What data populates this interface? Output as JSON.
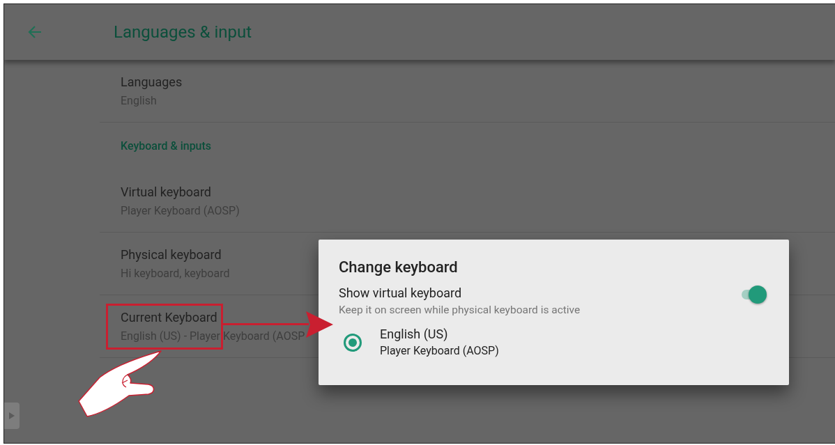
{
  "app_bar": {
    "title": "Languages & input"
  },
  "sections": [
    {
      "items": [
        {
          "title": "Languages",
          "summary": "English",
          "highlighted": false
        }
      ]
    },
    {
      "header": "Keyboard & inputs",
      "items": [
        {
          "title": "Virtual keyboard",
          "summary": "Player Keyboard (AOSP)",
          "highlighted": false
        },
        {
          "title": "Physical keyboard",
          "summary": "Hi keyboard, keyboard",
          "highlighted": false
        },
        {
          "title": "Current Keyboard",
          "summary": "English (US) - Player Keyboard (AOSP",
          "highlighted": true
        }
      ]
    }
  ],
  "dialog": {
    "title": "Change keyboard",
    "switch": {
      "label": "Show virtual keyboard",
      "summary": "Keep it on screen while physical keyboard is active",
      "on": true
    },
    "options": [
      {
        "title": "English (US)",
        "summary": "Player Keyboard (AOSP)",
        "selected": true
      }
    ]
  }
}
